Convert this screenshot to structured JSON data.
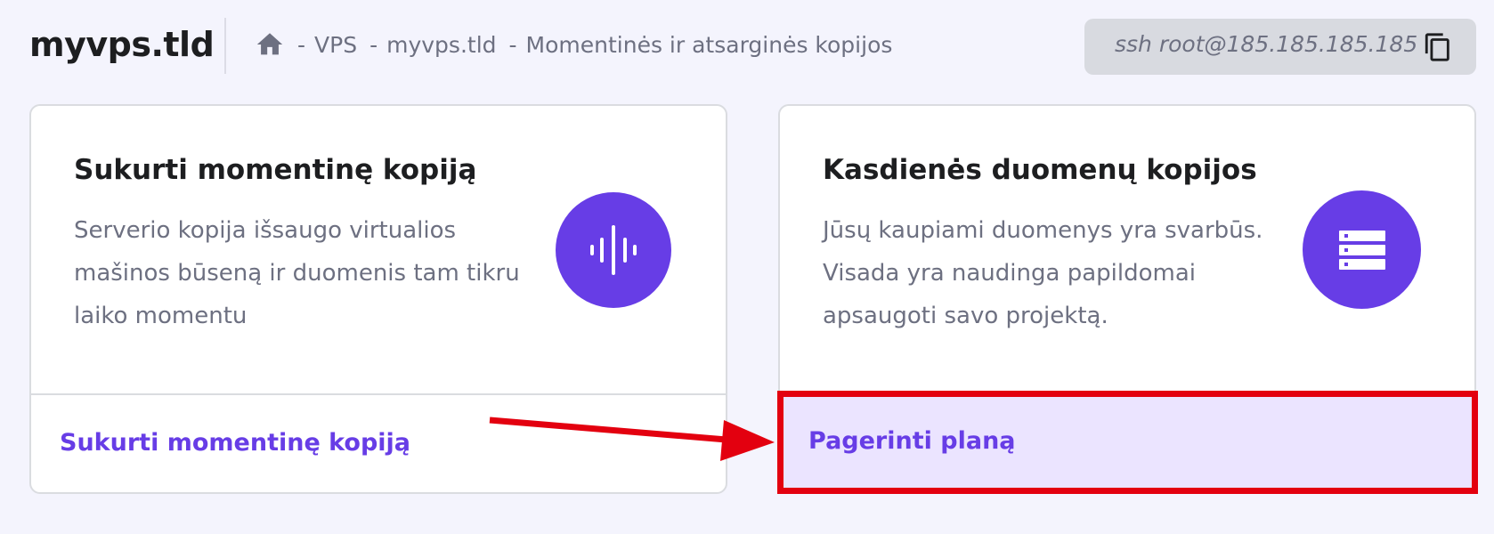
{
  "header": {
    "hostname": "myvps.tld",
    "breadcrumb": [
      "VPS",
      "myvps.tld",
      "Momentinės ir atsarginės kopijos"
    ],
    "breadcrumb_separator": "-",
    "ssh_command": "ssh root@185.185.185.185"
  },
  "cards": [
    {
      "title": "Sukurti momentinę kopiją",
      "description": "Serverio kopija išsaugo virtualios mašinos būseną ir duomenis tam tikru laiko momentu",
      "icon": "soundwave-icon",
      "action_label": "Sukurti momentinę kopiją"
    },
    {
      "title": "Kasdienės duomenų kopijos",
      "description": "Jūsų kaupiami duomenys yra svarbūs. Visada yra naudinga papildomai apsaugoti savo projektą.",
      "icon": "server-icon",
      "action_label": "Pagerinti planą"
    }
  ],
  "colors": {
    "accent": "#673de6",
    "highlight_border": "#e3000f",
    "highlight_bg": "#ebe4ff",
    "page_bg": "#f4f4fd"
  }
}
